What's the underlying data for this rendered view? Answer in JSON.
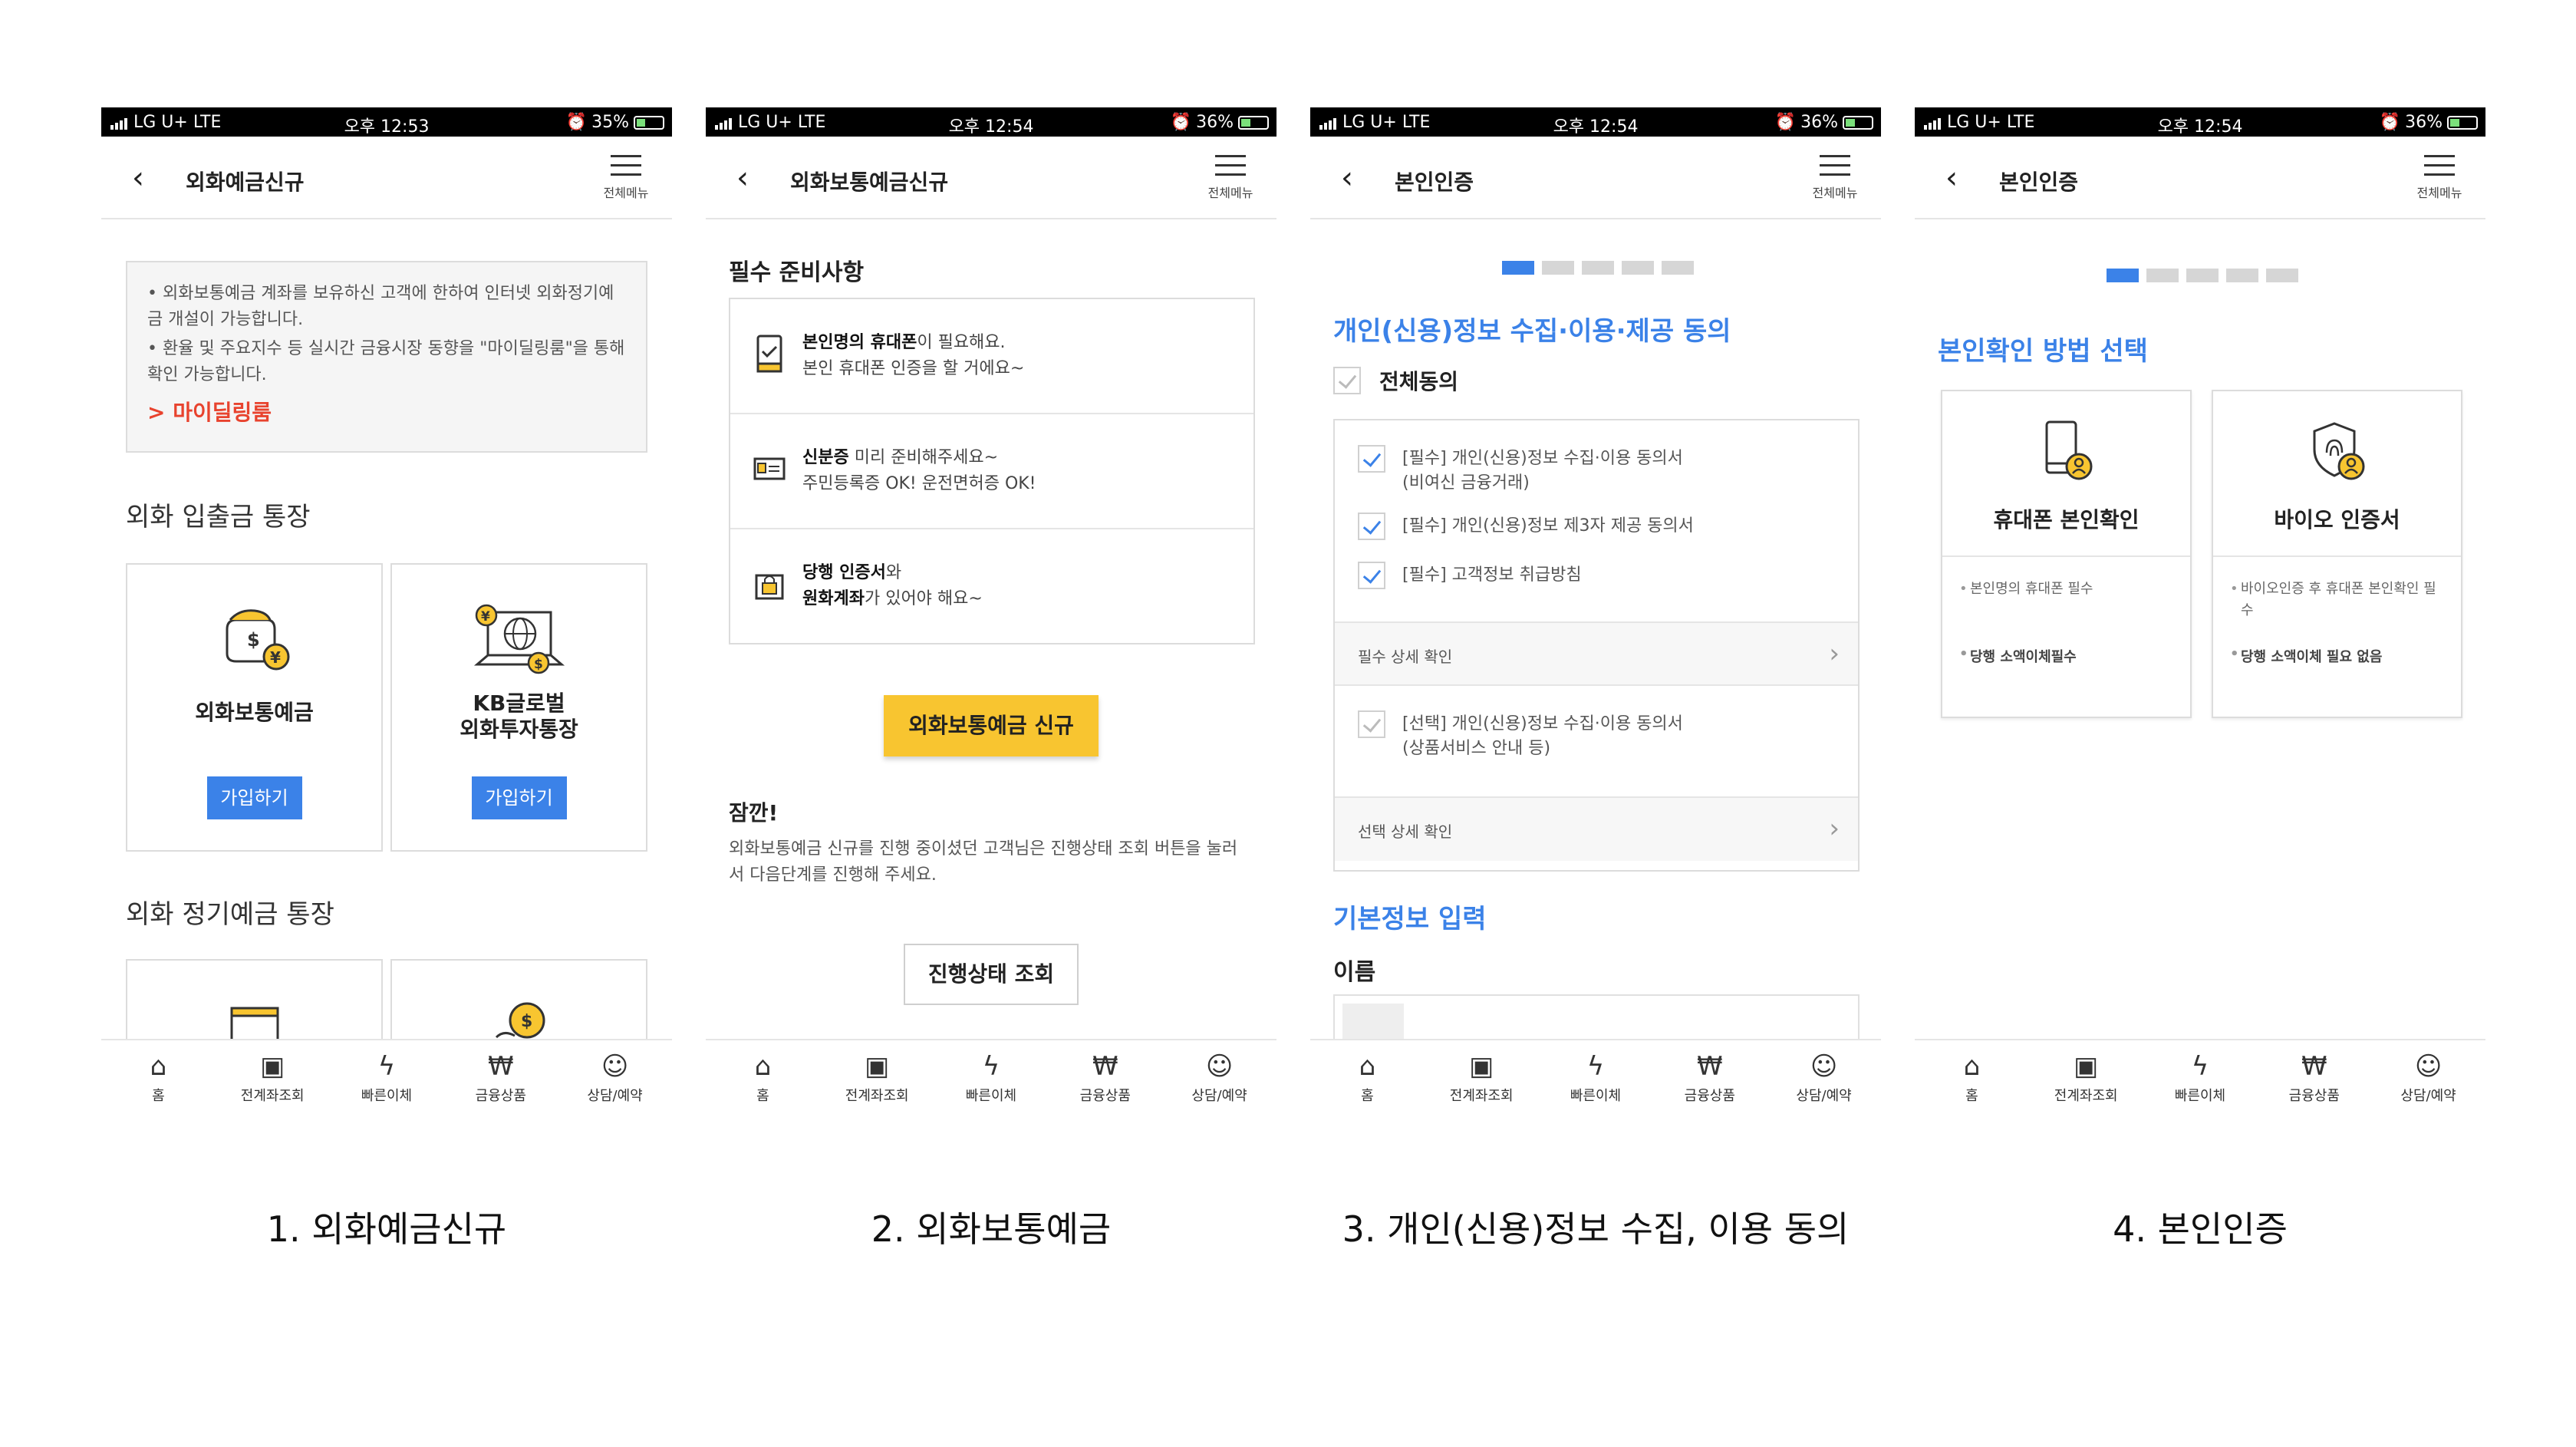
{
  "screens": [
    {
      "status": {
        "carrier": "LG U+  LTE",
        "time": "오후 12:53",
        "battery": "35%",
        "battery_level": 0.35
      },
      "title": "외화예금신규",
      "menu_label": "전체메뉴",
      "notice": {
        "line1": "• 외화보통예금 계좌를 보유하신 고객에 한하여 인터넷 외화정기예금 개설이 가능합니다.",
        "line2": "• 환율 및 주요지수 등 실시간 금융시장 동향을 \"마이딜링룸\"을 통해 확인 가능합니다.",
        "link": "> 마이딜링룸"
      },
      "section1": "외화 입출금 통장",
      "products": [
        {
          "name": "외화보통예금",
          "button": "가입하기"
        },
        {
          "name": "KB글로벌\n외화투자통장",
          "button": "가입하기"
        }
      ],
      "section2": "외화 정기예금 통장",
      "caption": "1. 외화예금신규"
    },
    {
      "status": {
        "carrier": "LG U+  LTE",
        "time": "오후 12:54",
        "battery": "36%",
        "battery_level": 0.36
      },
      "title": "외화보통예금신규",
      "menu_label": "전체메뉴",
      "prep_title": "필수 준비사항",
      "prep": [
        {
          "bold": "본인명의 휴대폰",
          "text1": "이 필요해요.",
          "text2": "본인 휴대폰 인증을 할 거에요~"
        },
        {
          "bold": "신분증",
          "text1": " 미리 준비해주세요~",
          "text2": "주민등록증 OK! 운전면허증 OK!"
        },
        {
          "bold": "당행 인증서",
          "text1": "와",
          "bold2": "원화계좌",
          "text2": "가 있어야 해요~"
        }
      ],
      "primary_button": "외화보통예금 신규",
      "wait_title": "잠깐!",
      "wait_text": "외화보통예금 신규를 진행 중이셨던 고객님은 진행상태 조회 버튼을 눌러서 다음단계를 진행해 주세요.",
      "status_button": "진행상태 조회",
      "caption": "2. 외화보통예금"
    },
    {
      "status": {
        "carrier": "LG U+  LTE",
        "time": "오후 12:54",
        "battery": "36%",
        "battery_level": 0.36
      },
      "title": "본인인증",
      "menu_label": "전체메뉴",
      "agree_title": "개인(신용)정보 수집·이용·제공 동의",
      "all_agree": "전체동의",
      "required": [
        "[필수] 개인(신용)정보 수집·이용 동의서\n(비여신 금융거래)",
        "[필수] 개인(신용)정보 제3자 제공 동의서",
        "[필수] 고객정보 취급방침"
      ],
      "required_detail": "필수 상세 확인",
      "optional": "[선택] 개인(신용)정보 수집·이용 동의서\n(상품서비스 안내 등)",
      "optional_detail": "선택 상세 확인",
      "basic_title": "기본정보 입력",
      "name_label": "이름",
      "caption": "3. 개인(신용)정보 수집, 이용 동의"
    },
    {
      "status": {
        "carrier": "LG U+  LTE",
        "time": "오후 12:54",
        "battery": "36%",
        "battery_level": 0.36
      },
      "title": "본인인증",
      "menu_label": "전체메뉴",
      "method_title": "본인확인 방법 선택",
      "methods": [
        {
          "name": "휴대폰 본인확인",
          "desc": "본인명의 휴대폰 필수",
          "note": "당행 소액이체필수"
        },
        {
          "name": "바이오 인증서",
          "desc": "바이오인증 후 휴대폰 본인확인 필수",
          "note": "당행 소액이체 필요 없음"
        }
      ],
      "caption": "4. 본인인증"
    }
  ],
  "tabbar": [
    {
      "label": "홈",
      "icon": "home-icon"
    },
    {
      "label": "전계좌조회",
      "icon": "account-search-icon"
    },
    {
      "label": "빠른이체",
      "icon": "lightning-icon"
    },
    {
      "label": "금융상품",
      "icon": "product-icon"
    },
    {
      "label": "상담/예약",
      "icon": "headset-icon"
    }
  ],
  "colors": {
    "accent_blue": "#3b82e8",
    "accent_yellow": "#f8c530",
    "link_red": "#e8432e"
  }
}
